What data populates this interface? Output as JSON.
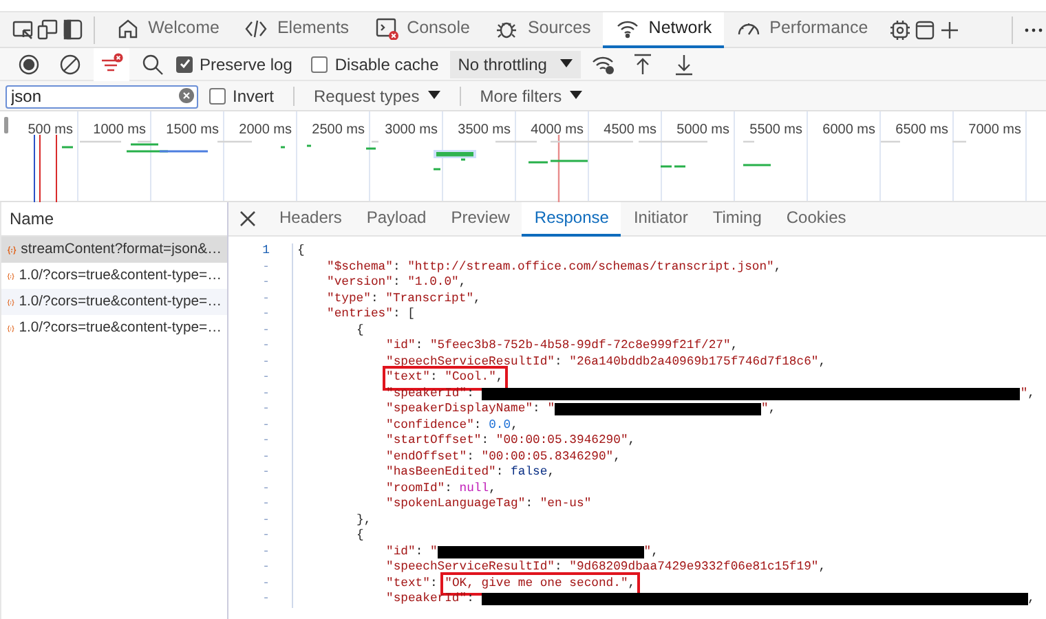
{
  "tab_bar": {
    "tabs": [
      {
        "label": "Welcome",
        "selected": false
      },
      {
        "label": "Elements",
        "selected": false
      },
      {
        "label": "Console",
        "selected": false
      },
      {
        "label": "Sources",
        "selected": false
      },
      {
        "label": "Network",
        "selected": true
      },
      {
        "label": "Performance",
        "selected": false
      }
    ]
  },
  "toolbar": {
    "filter_active": true,
    "preserve_log": {
      "label": "Preserve log",
      "checked": true
    },
    "disable_cache": {
      "label": "Disable cache",
      "checked": false
    },
    "throttling": {
      "value": "No throttling"
    }
  },
  "filter_bar": {
    "search": {
      "value": "json"
    },
    "invert": {
      "label": "Invert",
      "checked": false
    },
    "dropdowns": [
      "Request types",
      "More filters"
    ]
  },
  "timeline": {
    "ticks": [
      "500 ms",
      "1000 ms",
      "1500 ms",
      "2000 ms",
      "2500 ms",
      "3000 ms",
      "3500 ms",
      "4000 ms",
      "4500 ms",
      "5000 ms",
      "5500 ms",
      "6000 ms",
      "6500 ms",
      "7000 ms"
    ]
  },
  "requests": {
    "column": "Name",
    "rows": [
      {
        "name": "streamContent?format=json&…",
        "selected": true
      },
      {
        "name": "1.0/?cors=true&content-type=…",
        "selected": false
      },
      {
        "name": "1.0/?cors=true&content-type=…",
        "selected": false
      },
      {
        "name": "1.0/?cors=true&content-type=…",
        "selected": false
      }
    ]
  },
  "details": {
    "tabs": [
      {
        "label": "Headers",
        "selected": false
      },
      {
        "label": "Payload",
        "selected": false
      },
      {
        "label": "Preview",
        "selected": false
      },
      {
        "label": "Response",
        "selected": true
      },
      {
        "label": "Initiator",
        "selected": false
      },
      {
        "label": "Timing",
        "selected": false
      },
      {
        "label": "Cookies",
        "selected": false
      }
    ],
    "code": [
      {
        "gutter": "1",
        "parts": [
          {
            "kind": "punct",
            "text": "{"
          }
        ],
        "children": [
          {
            "gutter": "-",
            "parts": [
              {
                "kind": "key",
                "text": "\"$schema\""
              },
              {
                "kind": "punct",
                "text": ": "
              },
              {
                "kind": "string",
                "text": "\"http://stream.office.com/schemas/transcript.json\""
              },
              {
                "kind": "punct",
                "text": ","
              }
            ]
          },
          {
            "gutter": "-",
            "parts": [
              {
                "kind": "key",
                "text": "\"version\""
              },
              {
                "kind": "punct",
                "text": ": "
              },
              {
                "kind": "string",
                "text": "\"1.0.0\""
              },
              {
                "kind": "punct",
                "text": ","
              }
            ]
          },
          {
            "gutter": "-",
            "parts": [
              {
                "kind": "key",
                "text": "\"type\""
              },
              {
                "kind": "punct",
                "text": ": "
              },
              {
                "kind": "string",
                "text": "\"Transcript\""
              },
              {
                "kind": "punct",
                "text": ","
              }
            ]
          },
          {
            "gutter": "-",
            "parts": [
              {
                "kind": "key",
                "text": "\"entries\""
              },
              {
                "kind": "punct",
                "text": ": ["
              }
            ],
            "children": [
              {
                "gutter": "-",
                "parts": [
                  {
                    "kind": "punct",
                    "text": "{"
                  }
                ],
                "children": [
                  {
                    "gutter": "-",
                    "parts": [
                      {
                        "kind": "key",
                        "text": "\"id\""
                      },
                      {
                        "kind": "punct",
                        "text": ": "
                      },
                      {
                        "kind": "string",
                        "text": "\"5feec3b8-752b-4b58-99df-72c8e999f21f/27\""
                      },
                      {
                        "kind": "punct",
                        "text": ","
                      }
                    ]
                  },
                  {
                    "gutter": "-",
                    "parts": [
                      {
                        "kind": "key",
                        "text": "\"speechServiceResultId\""
                      },
                      {
                        "kind": "punct",
                        "text": ": "
                      },
                      {
                        "kind": "string",
                        "text": "\"26a140bddb2a40969b175f746d7f18c6\""
                      },
                      {
                        "kind": "punct",
                        "text": ","
                      }
                    ]
                  },
                  {
                    "gutter": "-",
                    "parts": [
                      {
                        "kind": "key",
                        "text": "\"text\"",
                        "boxed": true
                      },
                      {
                        "kind": "punct",
                        "text": ": ",
                        "boxed": true
                      },
                      {
                        "kind": "string",
                        "text": "\"Cool.\"",
                        "boxed": true
                      },
                      {
                        "kind": "punct",
                        "text": ",",
                        "boxed": true
                      }
                    ]
                  },
                  {
                    "gutter": "-",
                    "parts": [
                      {
                        "kind": "key",
                        "text": "\"speakerId\""
                      },
                      {
                        "kind": "punct",
                        "text": ": "
                      },
                      {
                        "kind": "redacted"
                      },
                      {
                        "kind": "string",
                        "text": "\""
                      },
                      {
                        "kind": "punct",
                        "text": ","
                      }
                    ]
                  },
                  {
                    "gutter": "-",
                    "parts": [
                      {
                        "kind": "key",
                        "text": "\"speakerDisplayName\""
                      },
                      {
                        "kind": "punct",
                        "text": ": "
                      },
                      {
                        "kind": "string",
                        "text": "\""
                      },
                      {
                        "kind": "redacted"
                      },
                      {
                        "kind": "string",
                        "text": "\""
                      },
                      {
                        "kind": "punct",
                        "text": ","
                      }
                    ]
                  },
                  {
                    "gutter": "-",
                    "parts": [
                      {
                        "kind": "key",
                        "text": "\"confidence\""
                      },
                      {
                        "kind": "punct",
                        "text": ": "
                      },
                      {
                        "kind": "number",
                        "text": "0.0"
                      },
                      {
                        "kind": "punct",
                        "text": ","
                      }
                    ]
                  },
                  {
                    "gutter": "-",
                    "parts": [
                      {
                        "kind": "key",
                        "text": "\"startOffset\""
                      },
                      {
                        "kind": "punct",
                        "text": ": "
                      },
                      {
                        "kind": "string",
                        "text": "\"00:00:05.3946290\""
                      },
                      {
                        "kind": "punct",
                        "text": ","
                      }
                    ]
                  },
                  {
                    "gutter": "-",
                    "parts": [
                      {
                        "kind": "key",
                        "text": "\"endOffset\""
                      },
                      {
                        "kind": "punct",
                        "text": ": "
                      },
                      {
                        "kind": "string",
                        "text": "\"00:00:05.8346290\""
                      },
                      {
                        "kind": "punct",
                        "text": ","
                      }
                    ]
                  },
                  {
                    "gutter": "-",
                    "parts": [
                      {
                        "kind": "key",
                        "text": "\"hasBeenEdited\""
                      },
                      {
                        "kind": "punct",
                        "text": ": "
                      },
                      {
                        "kind": "keyword",
                        "text": "false"
                      },
                      {
                        "kind": "punct",
                        "text": ","
                      }
                    ]
                  },
                  {
                    "gutter": "-",
                    "parts": [
                      {
                        "kind": "key",
                        "text": "\"roomId\""
                      },
                      {
                        "kind": "punct",
                        "text": ": "
                      },
                      {
                        "kind": "null",
                        "text": "null"
                      },
                      {
                        "kind": "punct",
                        "text": ","
                      }
                    ]
                  },
                  {
                    "gutter": "-",
                    "parts": [
                      {
                        "kind": "key",
                        "text": "\"spokenLanguageTag\""
                      },
                      {
                        "kind": "punct",
                        "text": ": "
                      },
                      {
                        "kind": "string",
                        "text": "\"en-us\""
                      }
                    ]
                  }
                ]
              },
              {
                "gutter": "-",
                "parts": [
                  {
                    "kind": "punct",
                    "text": "},"
                  }
                ]
              },
              {
                "gutter": "-",
                "parts": [
                  {
                    "kind": "punct",
                    "text": "{"
                  }
                ],
                "children": [
                  {
                    "gutter": "-",
                    "parts": [
                      {
                        "kind": "key",
                        "text": "\"id\""
                      },
                      {
                        "kind": "punct",
                        "text": ": "
                      },
                      {
                        "kind": "string",
                        "text": "\""
                      },
                      {
                        "kind": "redacted"
                      },
                      {
                        "kind": "string",
                        "text": "\""
                      },
                      {
                        "kind": "punct",
                        "text": ","
                      }
                    ]
                  },
                  {
                    "gutter": "-",
                    "parts": [
                      {
                        "kind": "key",
                        "text": "\"speechServiceResultId\""
                      },
                      {
                        "kind": "punct",
                        "text": ": "
                      },
                      {
                        "kind": "string",
                        "text": "\"9d68209dbaa7429e9332f06e81c15f19\""
                      },
                      {
                        "kind": "punct",
                        "text": ","
                      }
                    ]
                  },
                  {
                    "gutter": "-",
                    "parts": [
                      {
                        "kind": "key",
                        "text": "\"text\""
                      },
                      {
                        "kind": "punct",
                        "text": ": "
                      },
                      {
                        "kind": "string",
                        "text": "\"OK, give me one second.\"",
                        "boxed": true
                      },
                      {
                        "kind": "punct",
                        "text": ",",
                        "boxed": true
                      }
                    ]
                  },
                  {
                    "gutter": "-",
                    "parts": [
                      {
                        "kind": "key",
                        "text": "\"speakerId\""
                      },
                      {
                        "kind": "punct",
                        "text": ": "
                      },
                      {
                        "kind": "redacted"
                      },
                      {
                        "kind": "punct",
                        "text": ","
                      }
                    ]
                  }
                ]
              }
            ]
          }
        ]
      }
    ]
  }
}
